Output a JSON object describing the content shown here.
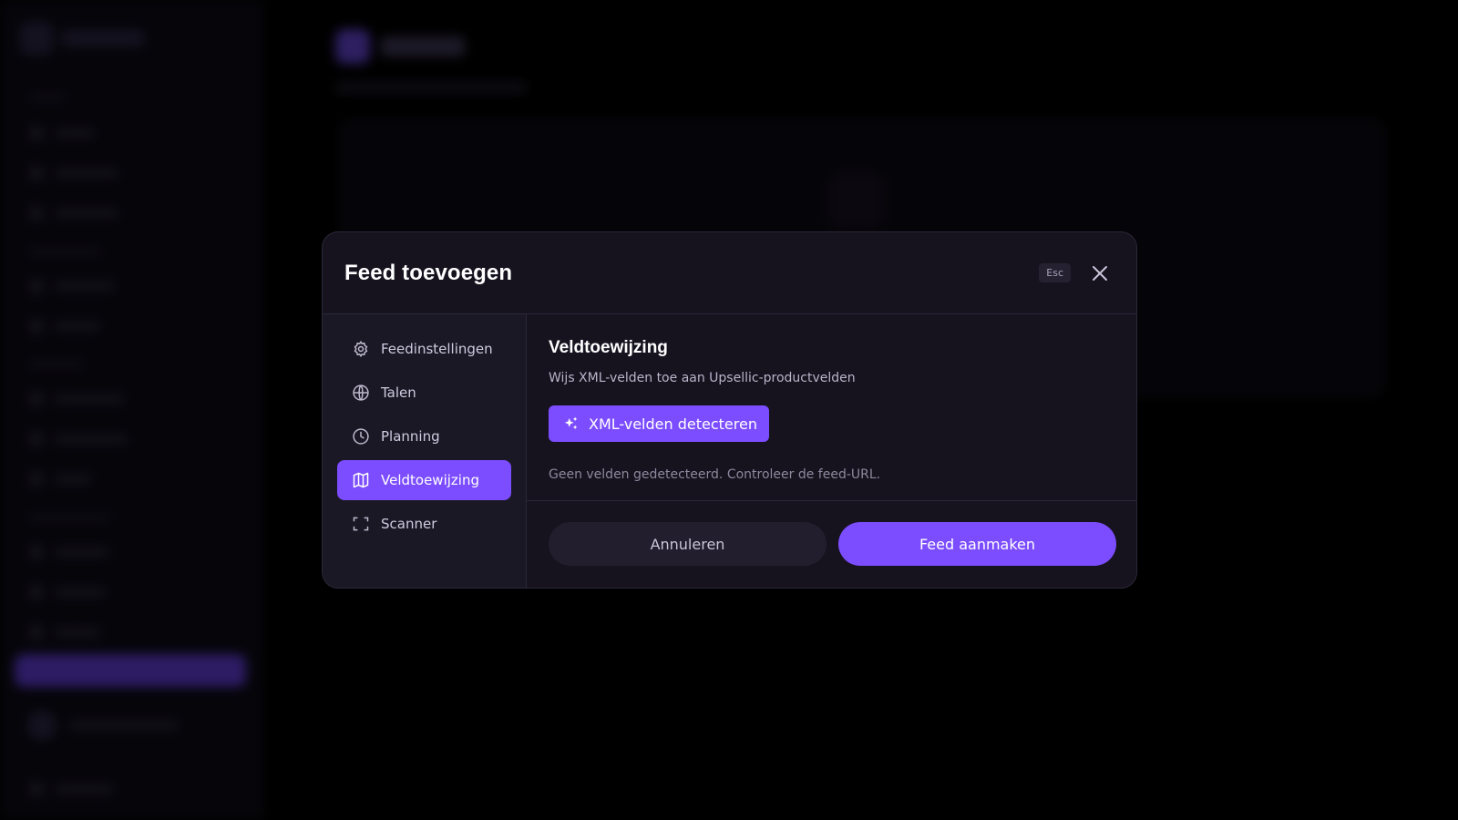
{
  "modal": {
    "title": "Feed toevoegen",
    "esc_label": "Esc",
    "nav": [
      {
        "label": "Feedinstellingen",
        "icon": "gear-icon"
      },
      {
        "label": "Talen",
        "icon": "globe-icon"
      },
      {
        "label": "Planning",
        "icon": "clock-icon"
      },
      {
        "label": "Veldtoewijzing",
        "icon": "map-icon",
        "active": true
      },
      {
        "label": "Scanner",
        "icon": "scan-icon"
      }
    ],
    "section": {
      "title": "Veldtoewijzing",
      "description": "Wijs XML-velden toe aan Upsellic-productvelden",
      "detect_button": "XML-velden detecteren",
      "empty_message": "Geen velden gedetecteerd. Controleer de feed-URL."
    },
    "footer": {
      "cancel_label": "Annuleren",
      "create_label": "Feed aanmaken"
    }
  },
  "colors": {
    "accent": "#7c4dff",
    "modal_bg": "#16131f",
    "sidebar_bg": "#1b1826"
  }
}
